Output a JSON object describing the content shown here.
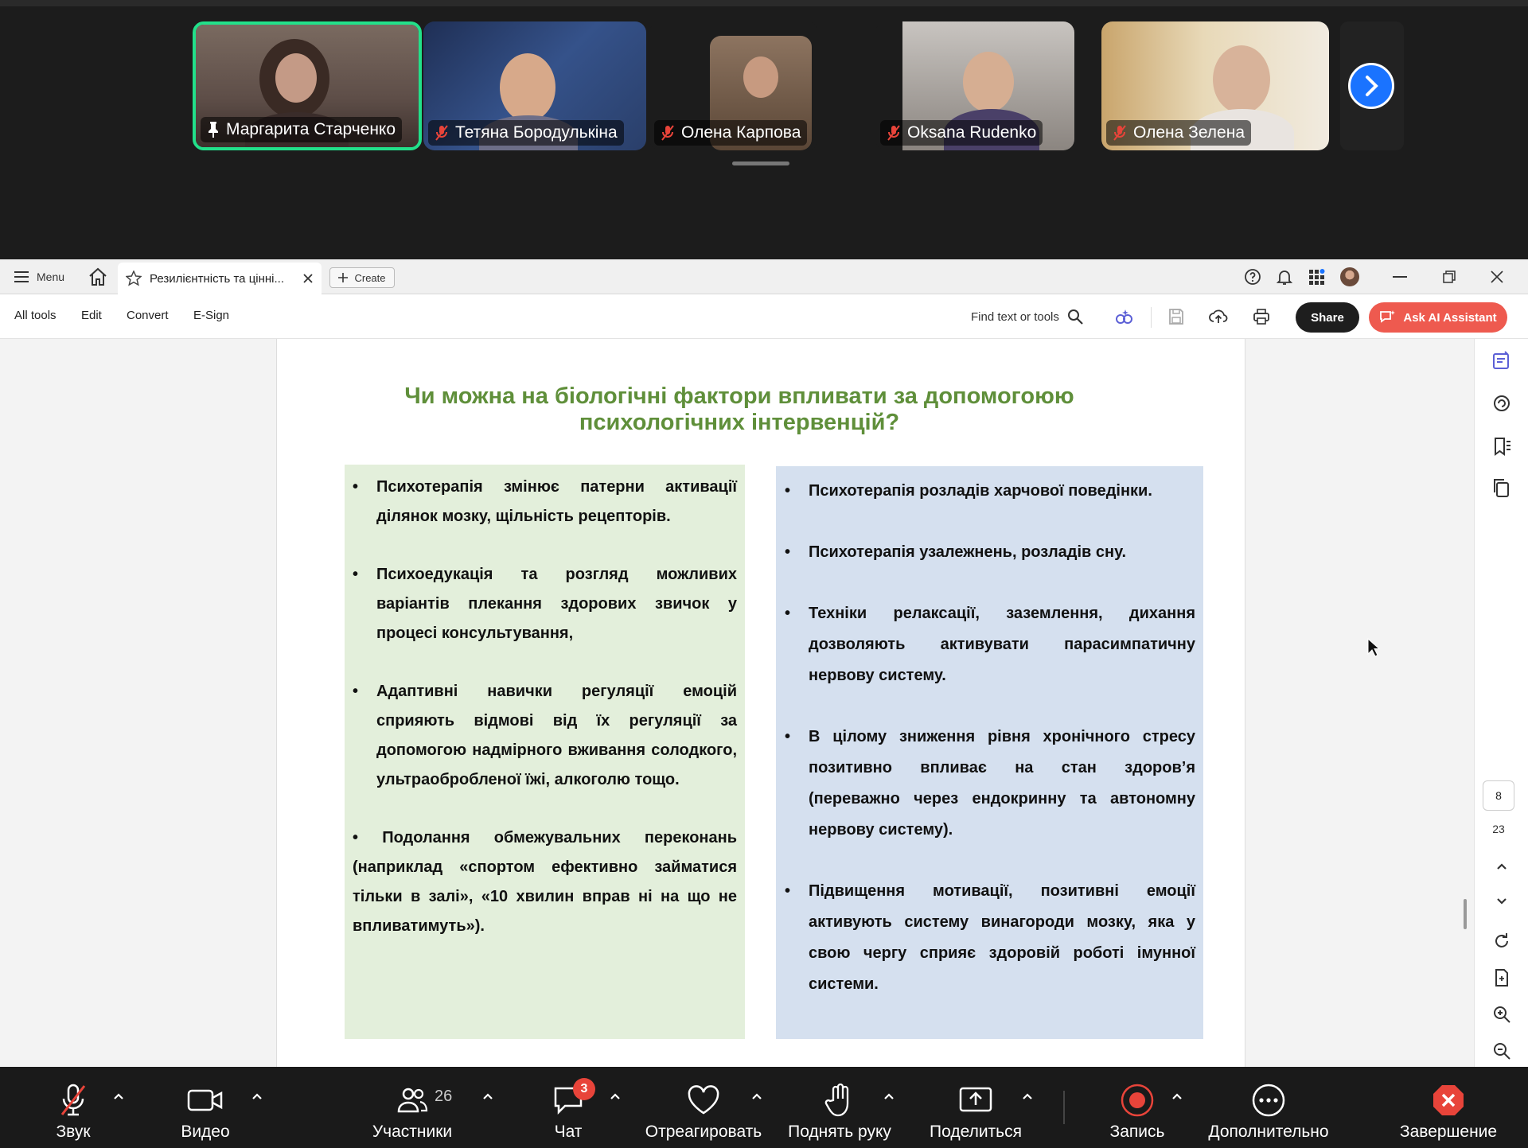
{
  "participants": [
    {
      "name": "Маргарита Старченко",
      "status": "pinned"
    },
    {
      "name": "Тетяна Бородулькіна",
      "status": "muted"
    },
    {
      "name": "Олена Карпова",
      "status": "muted"
    },
    {
      "name": "Oksana Rudenko",
      "status": "muted"
    },
    {
      "name": "Олена Зелена",
      "status": "muted"
    }
  ],
  "acrobat": {
    "menu_label": "Menu",
    "tab_title": "Резилієнтність та цінні...",
    "create_label": "Create",
    "toolbar": {
      "all_tools": "All tools",
      "edit": "Edit",
      "convert": "Convert",
      "esign": "E-Sign",
      "find_placeholder": "Find text or tools",
      "share": "Share",
      "ai_assistant": "Ask AI Assistant"
    },
    "page_current": "8",
    "page_total": "23"
  },
  "slide": {
    "title_line1": "Чи можна на біологічні фактори впливати за допомогоюю",
    "title_line2": "психологічних інтервенцій?",
    "left_items": [
      "Психотерапія змінює патерни активації ділянок мозку, щільність рецепторів.",
      "Психоедукація та розгляд можливих варіантів плекання здорових звичок у процесі консультування,",
      "Адаптивні навички регуляції емоцій сприяють відмові від їх регуляції за допомогою надмірного вживання солодкого, ультраоброб­леної їжі, алкоголю тощо.",
      "•   Подолання обмежувальних переконань (наприклад «спортом ефективно займатися тільки в залі», «10 хвилин вправ ні на що не впливатимуть»)."
    ],
    "right_items": [
      "Психотерапія розладів харчової поведінки.",
      "Психотерапія узалежнень, розладів сну.",
      "Техніки релаксації, заземлення, дихання дозволяють активувати парасимпатичну нервову систему.",
      "В цілому зниження рівня хронічного стресу позитивно впливає на стан здоров’я (переважно через ендокринну та автономну нервову систему).",
      "Підвищення мотивації, позитивні емоції активують систему винагороди мозку, яка у свою чергу сприяє здоровій роботі імунної системи."
    ]
  },
  "callbar": {
    "audio": "Звук",
    "video": "Видео",
    "participants": "Участники",
    "participants_count": "26",
    "chat": "Чат",
    "chat_badge": "3",
    "react": "Отреагировать",
    "raise_hand": "Поднять руку",
    "share": "Поделиться",
    "record": "Запись",
    "more": "Дополнительно",
    "end": "Завершение"
  },
  "colors": {
    "active_speaker": "#22e08a",
    "title_green": "#5f8f3a",
    "left_panel": "#e3efdb",
    "right_panel": "#d5e0ef",
    "ai_button": "#ee5a4f",
    "record_red": "#e8443a"
  }
}
